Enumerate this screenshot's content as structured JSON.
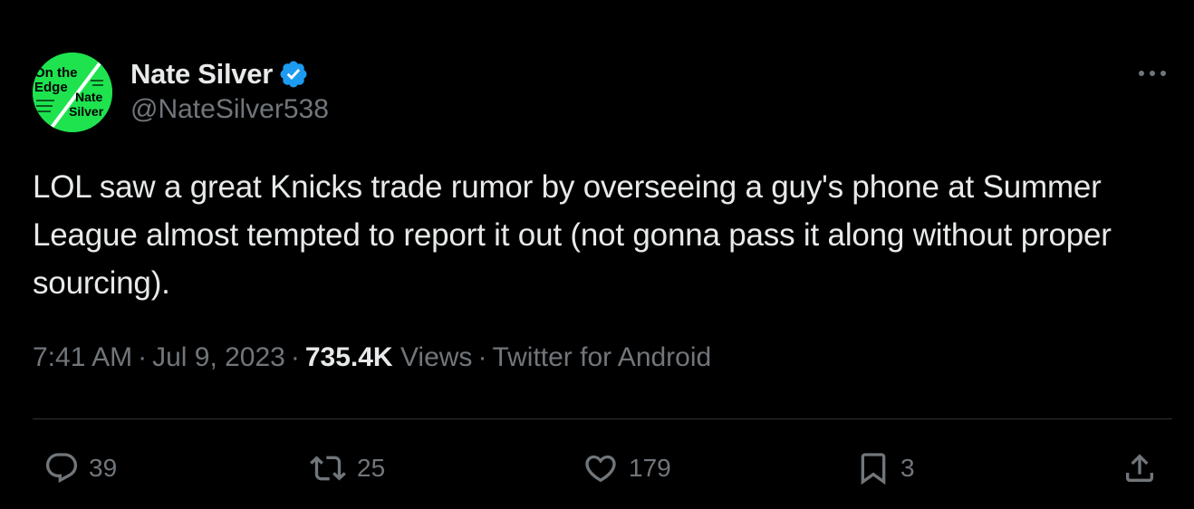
{
  "author": {
    "display_name": "Nate Silver",
    "handle": "@NateSilver538",
    "verified": true,
    "avatar": {
      "text_on_the": "On the",
      "text_edge": "Edge",
      "text_nate": "Nate",
      "text_silver": "Silver",
      "background": "#1ee34f"
    }
  },
  "tweet": {
    "text": "LOL saw a great Knicks trade rumor by overseeing a guy's phone at Summer League almost tempted to report it out (not gonna pass it along without proper sourcing).",
    "time": "7:41 AM",
    "date": "Jul 9, 2023",
    "views_count": "735.4K",
    "views_label": "Views",
    "source": "Twitter for Android",
    "separator": "·"
  },
  "actions": {
    "replies": "39",
    "retweets": "25",
    "likes": "179",
    "bookmarks": "3"
  },
  "icons": {
    "more": "more-horizontal-icon",
    "reply": "reply-icon",
    "retweet": "retweet-icon",
    "like": "heart-icon",
    "bookmark": "bookmark-icon",
    "share": "share-icon",
    "verified": "verified-badge-icon"
  },
  "colors": {
    "background": "#000000",
    "text_primary": "#e7e9ea",
    "text_secondary": "#71767b",
    "divider": "#2f3336",
    "verified_blue": "#1d9bf0",
    "avatar_green": "#1ee34f"
  }
}
